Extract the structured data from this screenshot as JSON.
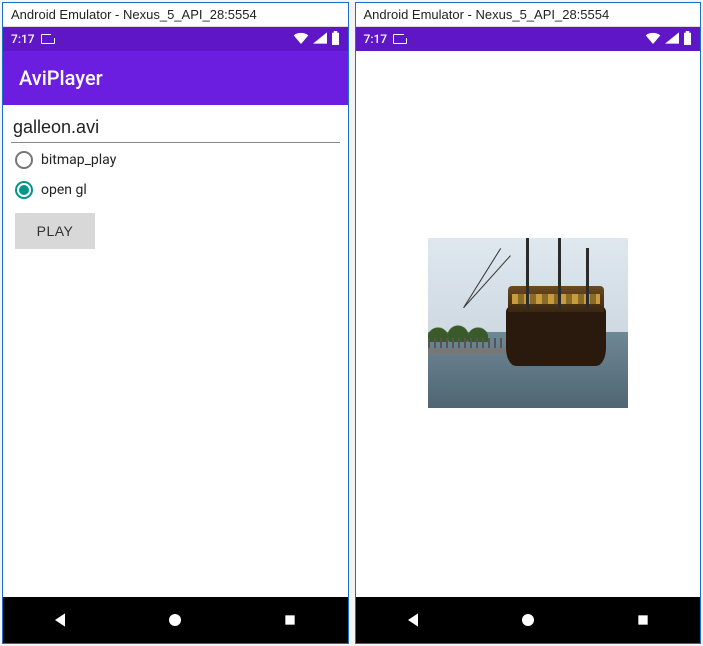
{
  "left": {
    "window_title": "Android Emulator - Nexus_5_API_28:5554",
    "status": {
      "time": "7:17"
    },
    "app_bar": {
      "title": "AviPlayer"
    },
    "filename_input": {
      "value": "galleon.avi"
    },
    "radios": {
      "bitmap": {
        "label": "bitmap_play",
        "checked": false
      },
      "opengl": {
        "label": "open gl",
        "checked": true
      }
    },
    "play_button": {
      "label": "PLAY"
    }
  },
  "right": {
    "window_title": "Android Emulator - Nexus_5_API_28:5554",
    "status": {
      "time": "7:17"
    }
  },
  "icons": {
    "sd": "sd-card-icon",
    "wifi": "wifi-icon",
    "signal": "signal-icon",
    "battery": "battery-icon",
    "back": "back-icon",
    "home": "home-icon",
    "recent": "recent-icon"
  }
}
